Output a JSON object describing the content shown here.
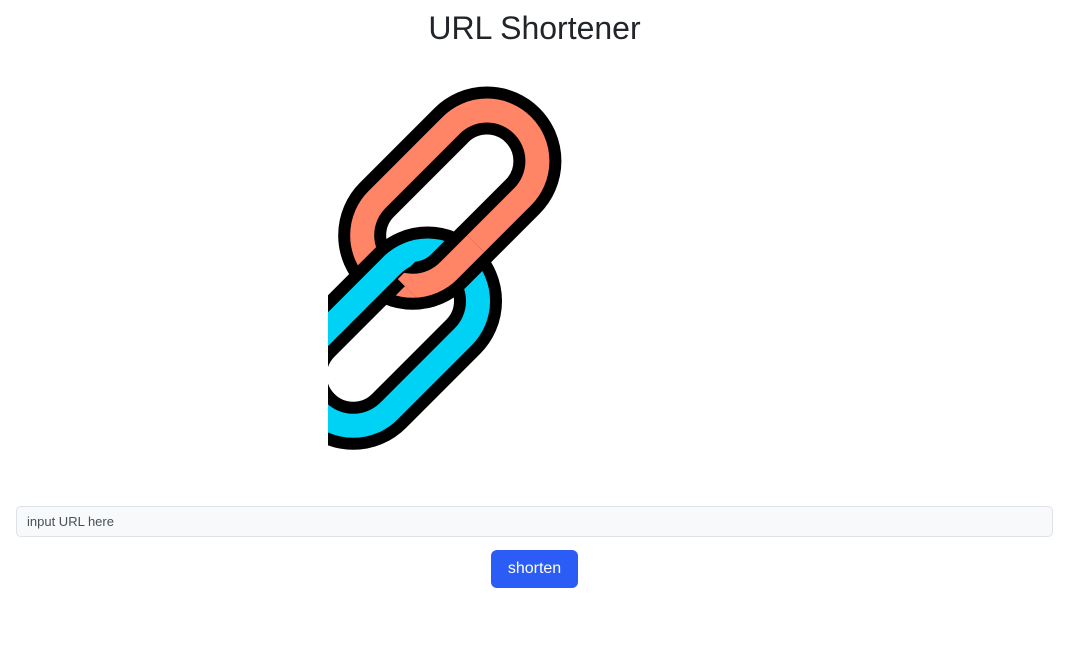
{
  "header": {
    "title": "URL Shortener"
  },
  "logo": {
    "icon": "chain-link-icon",
    "colors": {
      "back_link": "#ff8566",
      "front_link": "#00d2f5",
      "outline": "#000000"
    }
  },
  "form": {
    "url_input": {
      "value": "",
      "placeholder": "input URL here"
    },
    "submit_label": "shorten",
    "submit_color": "#2c5cf6"
  }
}
